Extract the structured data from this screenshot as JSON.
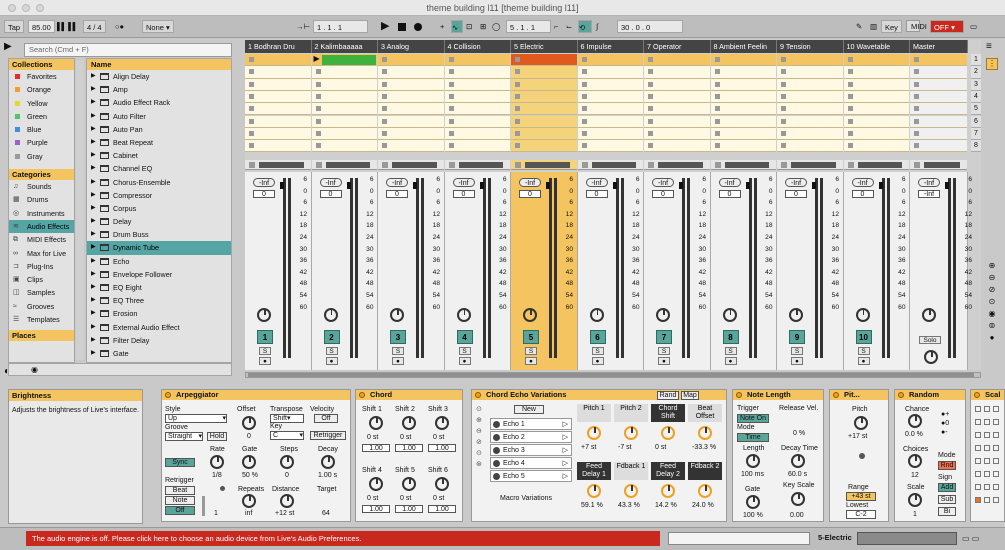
{
  "window": {
    "title": "theme building l11  [theme building l11]"
  },
  "toolbar": {
    "tap": "Tap",
    "tempo": "85.00",
    "time_sig": "4 / 4",
    "metro": "1 Bar",
    "quantize": "None",
    "arrangement_position": "1 .  1 .  1",
    "loop_start": "5 .  1 .  1",
    "loop_length": "30 .  0 .  0",
    "key_label": "Key",
    "midi_label": "MIDI",
    "off_label": "OFF"
  },
  "browser": {
    "search_placeholder": "Search (Cmd + F)",
    "collections_title": "Collections",
    "collections": [
      {
        "label": "Favorites",
        "color": "#e03030"
      },
      {
        "label": "Orange",
        "color": "#f39c2b"
      },
      {
        "label": "Yellow",
        "color": "#e5d631"
      },
      {
        "label": "Green",
        "color": "#52c56a"
      },
      {
        "label": "Blue",
        "color": "#3d8fe0"
      },
      {
        "label": "Purple",
        "color": "#9b5fd0"
      },
      {
        "label": "Gray",
        "color": "#9a9a9a"
      }
    ],
    "categories_title": "Categories",
    "categories": [
      {
        "label": "Sounds",
        "icon": "♫"
      },
      {
        "label": "Drums",
        "icon": "▦"
      },
      {
        "label": "Instruments",
        "icon": "◎"
      },
      {
        "label": "Audio Effects",
        "icon": "≋"
      },
      {
        "label": "MIDI Effects",
        "icon": "⧉"
      },
      {
        "label": "Max for Live",
        "icon": "∞"
      },
      {
        "label": "Plug-Ins",
        "icon": "⊐"
      },
      {
        "label": "Clips",
        "icon": "▣"
      },
      {
        "label": "Samples",
        "icon": "◫"
      },
      {
        "label": "Grooves",
        "icon": "≈"
      },
      {
        "label": "Templates",
        "icon": "☰"
      }
    ],
    "places_title": "Places",
    "name_header": "Name",
    "items": [
      "Align Delay",
      "Amp",
      "Audio Effect Rack",
      "Auto Filter",
      "Auto Pan",
      "Beat Repeat",
      "Cabinet",
      "Channel EQ",
      "Chorus-Ensemble",
      "Compressor",
      "Corpus",
      "Delay",
      "Drum Buss",
      "Dynamic Tube",
      "Echo",
      "Envelope Follower",
      "EQ Eight",
      "EQ Three",
      "Erosion",
      "External Audio Effect",
      "Filter Delay",
      "Gate"
    ]
  },
  "tracks": [
    {
      "name": "1 Bodhran Dru",
      "number": "1"
    },
    {
      "name": "2 Kalimbaaaaa",
      "number": "2"
    },
    {
      "name": "3 Analog",
      "number": "3"
    },
    {
      "name": "4 Collision",
      "number": "4"
    },
    {
      "name": "5 Electric",
      "number": "5"
    },
    {
      "name": "6 Impulse",
      "number": "6"
    },
    {
      "name": "7 Operator",
      "number": "7"
    },
    {
      "name": "8 Ambient Feelin",
      "number": "8"
    },
    {
      "name": "9 Tension",
      "number": "9"
    },
    {
      "name": "10 Wavetable",
      "number": "10"
    }
  ],
  "master": {
    "name": "Master",
    "solo": "Solo"
  },
  "mixer": {
    "inf": "-Inf",
    "zero": "0",
    "s": "S",
    "db_scale": [
      "6",
      "0",
      "6",
      "12",
      "18",
      "24",
      "30",
      "36",
      "42",
      "48",
      "54",
      "60"
    ]
  },
  "scenes": [
    "1",
    "2",
    "3",
    "4",
    "5",
    "6",
    "7",
    "8"
  ],
  "info": {
    "title": "Brightness",
    "text": "Adjusts the brightness of Live's interface."
  },
  "devices": {
    "arp": {
      "title": "Arpeggiator",
      "style_label": "Style",
      "style": "Up",
      "groove_label": "Groove",
      "groove": "Straight",
      "hold": "Hold",
      "offset_label": "Offset",
      "offset": "0",
      "transpose_label": "Transpose",
      "transpose": "Shift",
      "key_label": "Key",
      "key": "C",
      "velocity_label": "Velocity",
      "vel_off": "Off",
      "retrigger_btn": "Retrigger",
      "sync": "Sync",
      "rate_label": "Rate",
      "rate": "1/8",
      "gate_label": "Gate",
      "gate": "50 %",
      "steps_label": "Steps",
      "steps": "0",
      "decay_label": "Decay",
      "decay": "1.00 s",
      "retrigger_label": "Retrigger",
      "beat": "Beat",
      "note": "Note",
      "off": "Off",
      "repeats_label": "Repeats",
      "repeats": "inf",
      "one": "1",
      "distance_label": "Distance",
      "distance": "+12 st",
      "target_label": "Target",
      "target": "64"
    },
    "chord": {
      "title": "Chord",
      "shifts": [
        {
          "label": "Shift 1",
          "value": "0 st",
          "vel": "1.00"
        },
        {
          "label": "Shift 2",
          "value": "0 st",
          "vel": "1.00"
        },
        {
          "label": "Shift 3",
          "value": "0 st",
          "vel": "1.00"
        },
        {
          "label": "Shift 4",
          "value": "0 st",
          "vel": "1.00"
        },
        {
          "label": "Shift 5",
          "value": "0 st",
          "vel": "1.00"
        },
        {
          "label": "Shift 6",
          "value": "0 st",
          "vel": "1.00"
        }
      ]
    },
    "rack": {
      "title": "Chord Echo Variations",
      "rand": "Rand",
      "map": "Map",
      "new": "New",
      "chains": [
        "Echo 1",
        "Echo 2",
        "Echo 3",
        "Echo 4",
        "Echo 5"
      ],
      "macro_variations": "Macro Variations",
      "macros": [
        {
          "label": "Pitch 1",
          "value": "+7 st",
          "dark": false
        },
        {
          "label": "Pitch 2",
          "value": "-7 st",
          "dark": false
        },
        {
          "label": "Chord Shift",
          "value": "0 st",
          "dark": true
        },
        {
          "label": "Beat Offset",
          "value": "-33.3 %",
          "dark": false
        },
        {
          "label": "Feed Delay 1",
          "value": "59.1 %",
          "dark": true
        },
        {
          "label": "Fdback 1",
          "value": "43.3 %",
          "dark": false
        },
        {
          "label": "Feed Delay 2",
          "value": "14.2 %",
          "dark": true
        },
        {
          "label": "Fdback 2",
          "value": "24.0 %",
          "dark": true
        }
      ]
    },
    "notelen": {
      "title": "Note Length",
      "trigger_label": "Trigger",
      "trigger": "Note On",
      "release_label": "Release Vel.",
      "release": "0 %",
      "mode_label": "Mode",
      "mode": "Time",
      "length_label": "Length",
      "length": "100 ms",
      "decay_label": "Decay Time",
      "decay": "60.0 s",
      "gate_label": "Gate",
      "gate": "100 %",
      "keyscale_label": "Key Scale",
      "keyscale": "0.00"
    },
    "pitch": {
      "title": "Pit...",
      "pitch_label": "Pitch",
      "pitch": "+17 st",
      "range_label": "Range",
      "range": "+43 st",
      "lowest_label": "Lowest",
      "lowest": "C-2"
    },
    "random": {
      "title": "Random",
      "chance_label": "Chance",
      "chance": "0.0 %",
      "choices_label": "Choices",
      "choices": "12",
      "scale_label": "Scale",
      "scale": "1",
      "mode_label": "Mode",
      "mode": "Rnd",
      "sign_label": "Sign",
      "add": "Add",
      "sub": "Sub",
      "bi": "Bi",
      "plus": "+",
      "zero": "0",
      "minus": "-"
    },
    "scale": {
      "title": "Scal"
    }
  },
  "status": {
    "message": "The audio engine is off. Please click here to choose an audio device from Live's Audio Preferences.",
    "track": "5-Electric"
  }
}
